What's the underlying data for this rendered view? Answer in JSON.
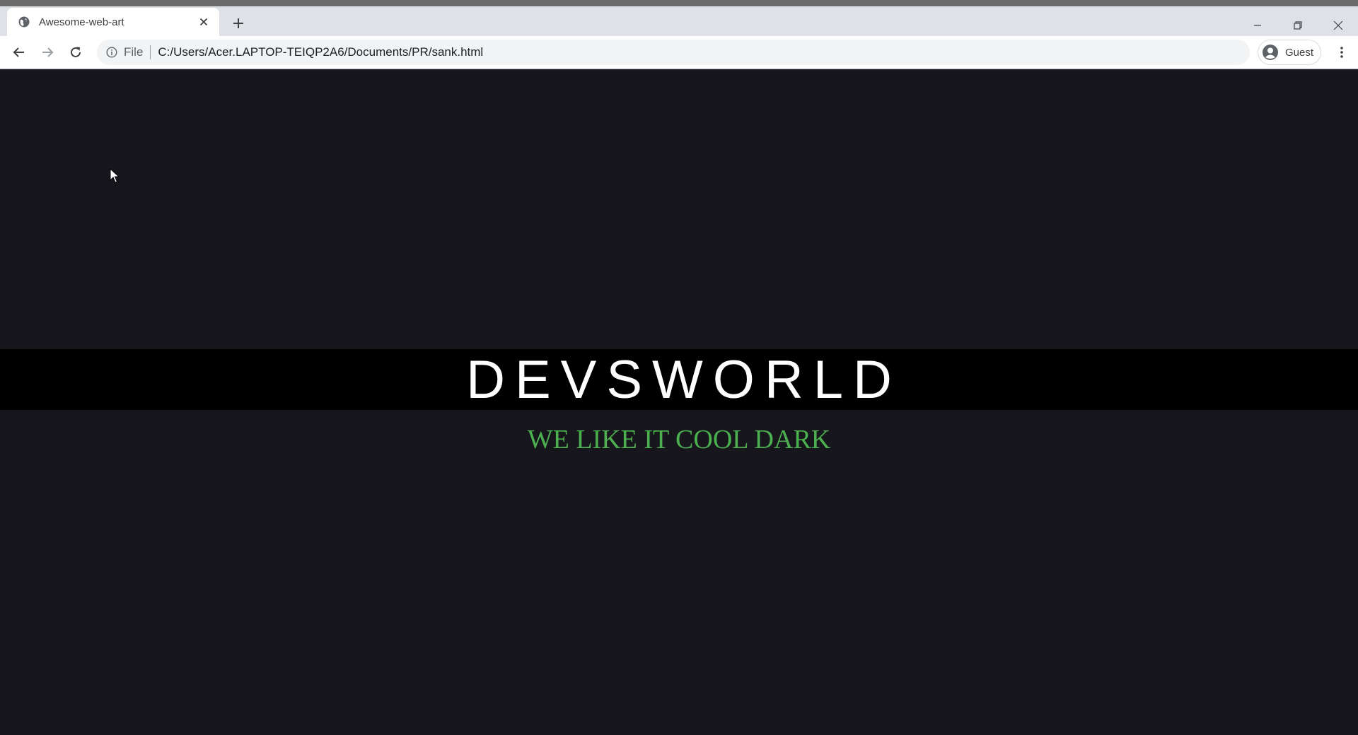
{
  "browser": {
    "tab": {
      "title": "Awesome-web-art",
      "favicon": "globe-icon"
    },
    "address_bar": {
      "scheme_label": "File",
      "url": "C:/Users/Acer.LAPTOP-TEIQP2A6/Documents/PR/sank.html"
    },
    "profile": {
      "label": "Guest"
    },
    "icons": {
      "back": "back-arrow-icon",
      "forward": "forward-arrow-icon",
      "reload": "reload-icon",
      "info": "info-icon",
      "menu": "kebab-menu-icon",
      "new_tab": "plus-icon",
      "close_tab": "close-icon",
      "minimize": "minimize-icon",
      "restore": "restore-icon",
      "close_window": "close-icon"
    }
  },
  "page": {
    "heading": "DEVSWORLD",
    "tagline": "WE LIKE IT COOL DARK",
    "colors": {
      "background": "#17161c",
      "band": "#000000",
      "heading": "#ffffff",
      "tagline": "#4caf50"
    }
  }
}
